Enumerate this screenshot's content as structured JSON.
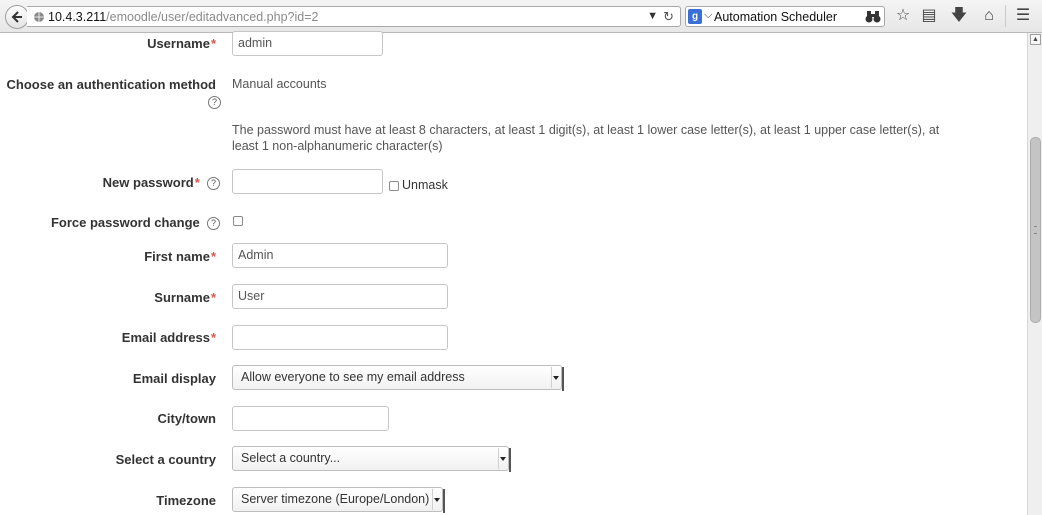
{
  "browser": {
    "url_host": "10.4.3.211",
    "url_path": "/emoodle/user/editadvanced.php?id=2",
    "search_text": "Automation Scheduler"
  },
  "form": {
    "username": {
      "label": "Username",
      "value": "admin"
    },
    "auth": {
      "label_line1": "Choose an authentication method",
      "value": "Manual accounts"
    },
    "password_rules": "The password must have at least 8 characters, at least 1 digit(s), at least 1 lower case letter(s), at least 1 upper case letter(s), at least 1 non-alphanumeric character(s)",
    "new_password": {
      "label": "New password",
      "value": "",
      "unmask_label": "Unmask"
    },
    "force_change": {
      "label": "Force password change",
      "checked": false
    },
    "first_name": {
      "label": "First name",
      "value": "Admin"
    },
    "surname": {
      "label": "Surname",
      "value": "User"
    },
    "email": {
      "label": "Email address",
      "value": ""
    },
    "email_display": {
      "label": "Email display",
      "value": "Allow everyone to see my email address"
    },
    "city": {
      "label": "City/town",
      "value": ""
    },
    "country": {
      "label": "Select a country",
      "value": "Select a country..."
    },
    "timezone": {
      "label": "Timezone",
      "value": "Server timezone (Europe/London)"
    },
    "required_marker": "*",
    "help_glyph": "?"
  },
  "colors": {
    "required": "#d9534f",
    "label": "#333333"
  }
}
